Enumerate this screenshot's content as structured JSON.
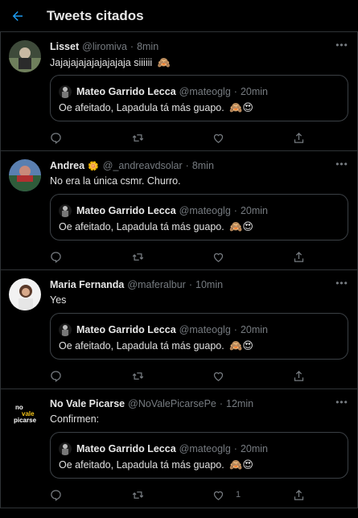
{
  "header": {
    "title": "Tweets citados"
  },
  "colors": {
    "background": "#000000",
    "accent": "#1d9bf0",
    "muted": "#767b80",
    "border": "#2f3336"
  },
  "quoted": {
    "name": "Mateo Garrido Lecca",
    "handle": "@mateoglg",
    "time": "20min",
    "text": "Oe afeitado, Lapadula tá más guapo."
  },
  "tweets": [
    {
      "name": "Lisset",
      "badge": "",
      "handle": "@liromiva",
      "time": "8min",
      "text": "Jajajajajajajajajaja siiiiii",
      "text_emoji": "🙈",
      "like_count": ""
    },
    {
      "name": "Andrea",
      "badge": "🌼",
      "handle": "@_andreavdsolar",
      "time": "8min",
      "text": "No era la única csmr. Churro.",
      "text_emoji": "",
      "like_count": ""
    },
    {
      "name": "Maria Fernanda",
      "badge": "",
      "handle": "@maferalbur",
      "time": "10min",
      "text": "Yes",
      "text_emoji": "",
      "like_count": ""
    },
    {
      "name": "No Vale Picarse",
      "badge": "",
      "handle": "@NoValePicarsePe",
      "time": "12min",
      "text": "Confirmen:",
      "text_emoji": "",
      "like_count": "1"
    }
  ],
  "avatar_logo": {
    "line1": "no",
    "line2": "vale",
    "line3": "picarse"
  },
  "separator": "·",
  "quote_emojis": "🙈😍",
  "icons": [
    "back-arrow-icon",
    "more-icon",
    "reply-icon",
    "retweet-icon",
    "like-icon",
    "share-icon"
  ]
}
